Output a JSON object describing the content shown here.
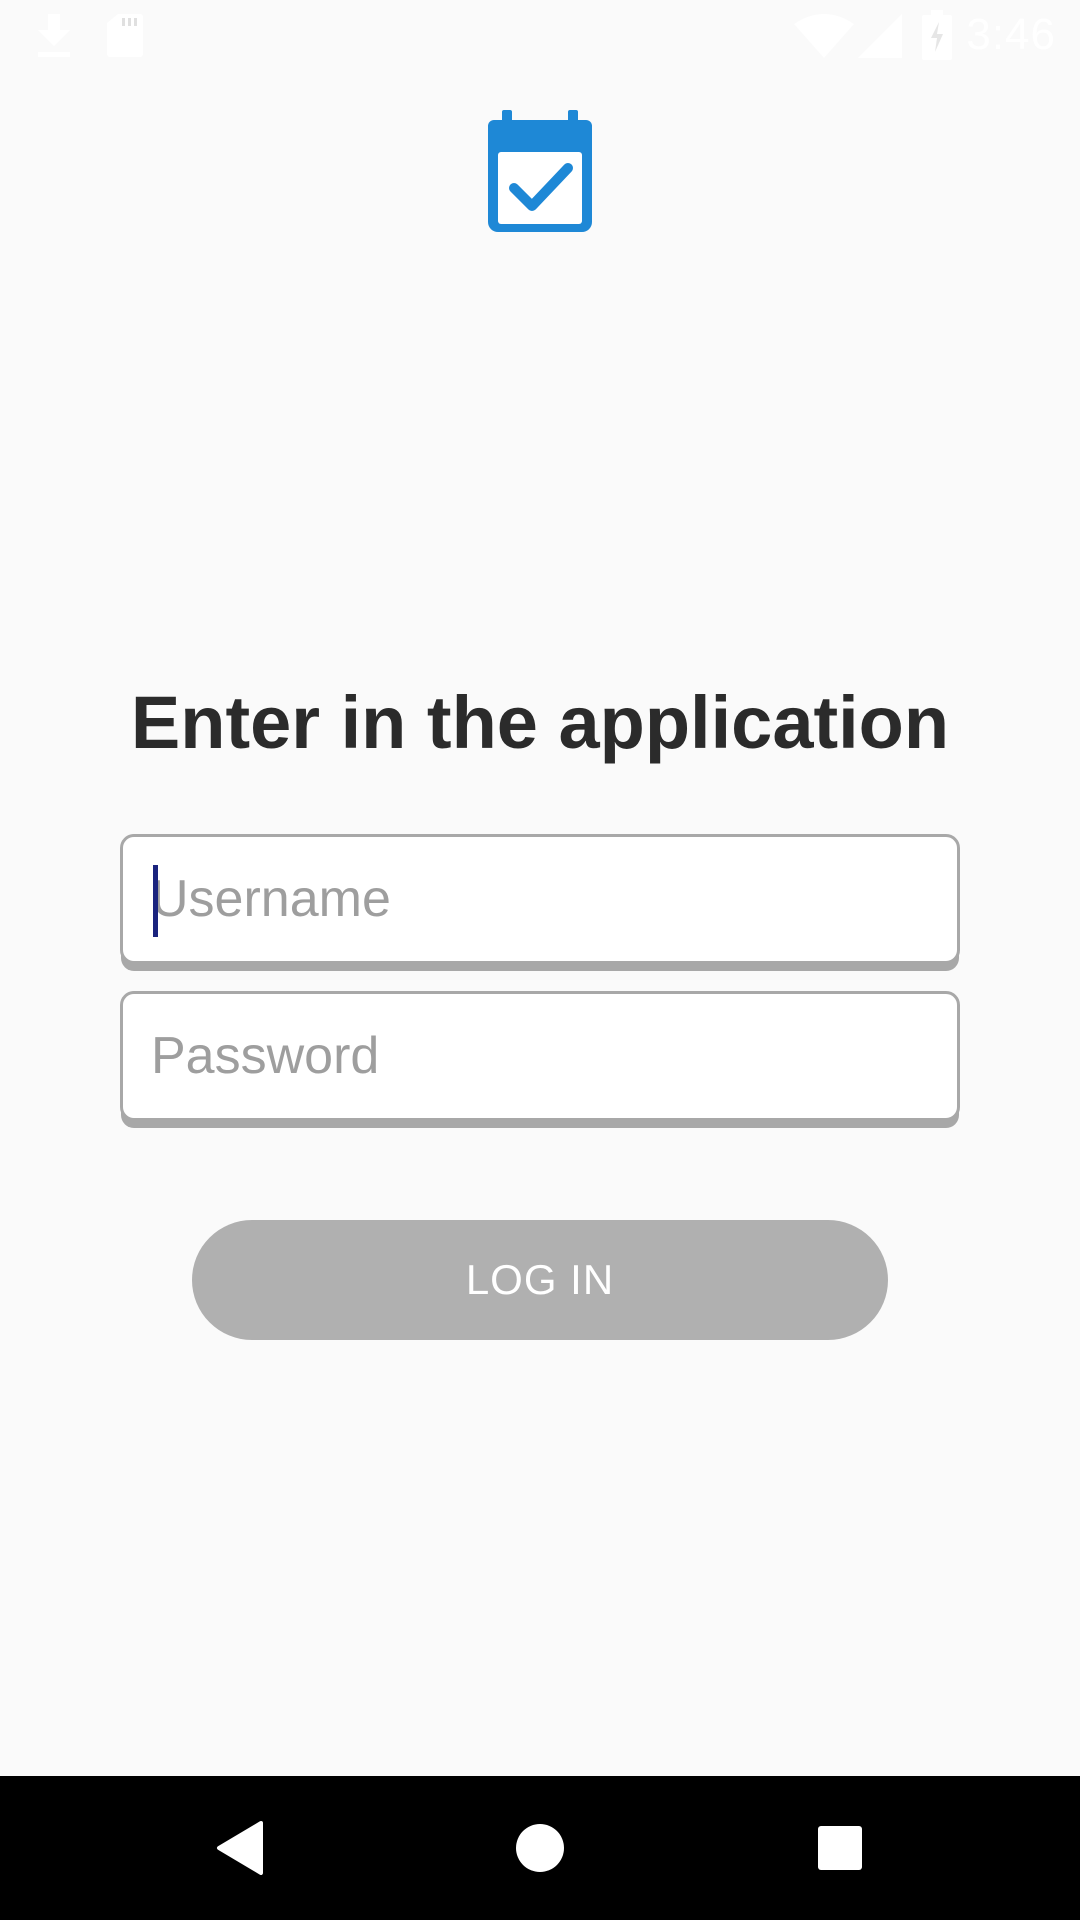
{
  "status_bar": {
    "time": "3:46",
    "icons": [
      "download-icon",
      "sd-card-icon",
      "wifi-icon",
      "signal-icon",
      "battery-icon"
    ]
  },
  "app": {
    "logo_icon": "calendar-check-icon",
    "accent_color": "#1e88d6"
  },
  "login": {
    "title": "Enter in the application",
    "username": {
      "value": "",
      "placeholder": "Username"
    },
    "password": {
      "value": "",
      "placeholder": "Password"
    },
    "submit_label": "LOG IN"
  },
  "nav_bar": {
    "buttons": [
      "back-icon",
      "home-icon",
      "recents-icon"
    ]
  }
}
